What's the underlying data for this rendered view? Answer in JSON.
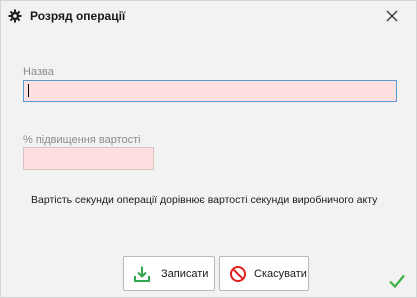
{
  "window": {
    "title": "Розряд операції",
    "title_icon": "gear-icon",
    "close_icon": "close-icon"
  },
  "form": {
    "name_label": "Назва",
    "name_value": "",
    "markup_label": "% підвищення вартості",
    "markup_value": "",
    "info_text": "Вартість секунди операції дорівнює вартості секунди виробничого акту"
  },
  "buttons": {
    "save_label": "Записати",
    "save_icon": "save-download-icon",
    "cancel_label": "Скасувати",
    "cancel_icon": "cancel-icon"
  },
  "status": {
    "icon": "checkmark-icon"
  },
  "colors": {
    "required_field_bg": "#ffe0e0",
    "focus_border": "#5b9bd5",
    "save_icon": "#2fa84f",
    "cancel_icon": "#e02020",
    "checkmark": "#3cb043"
  }
}
